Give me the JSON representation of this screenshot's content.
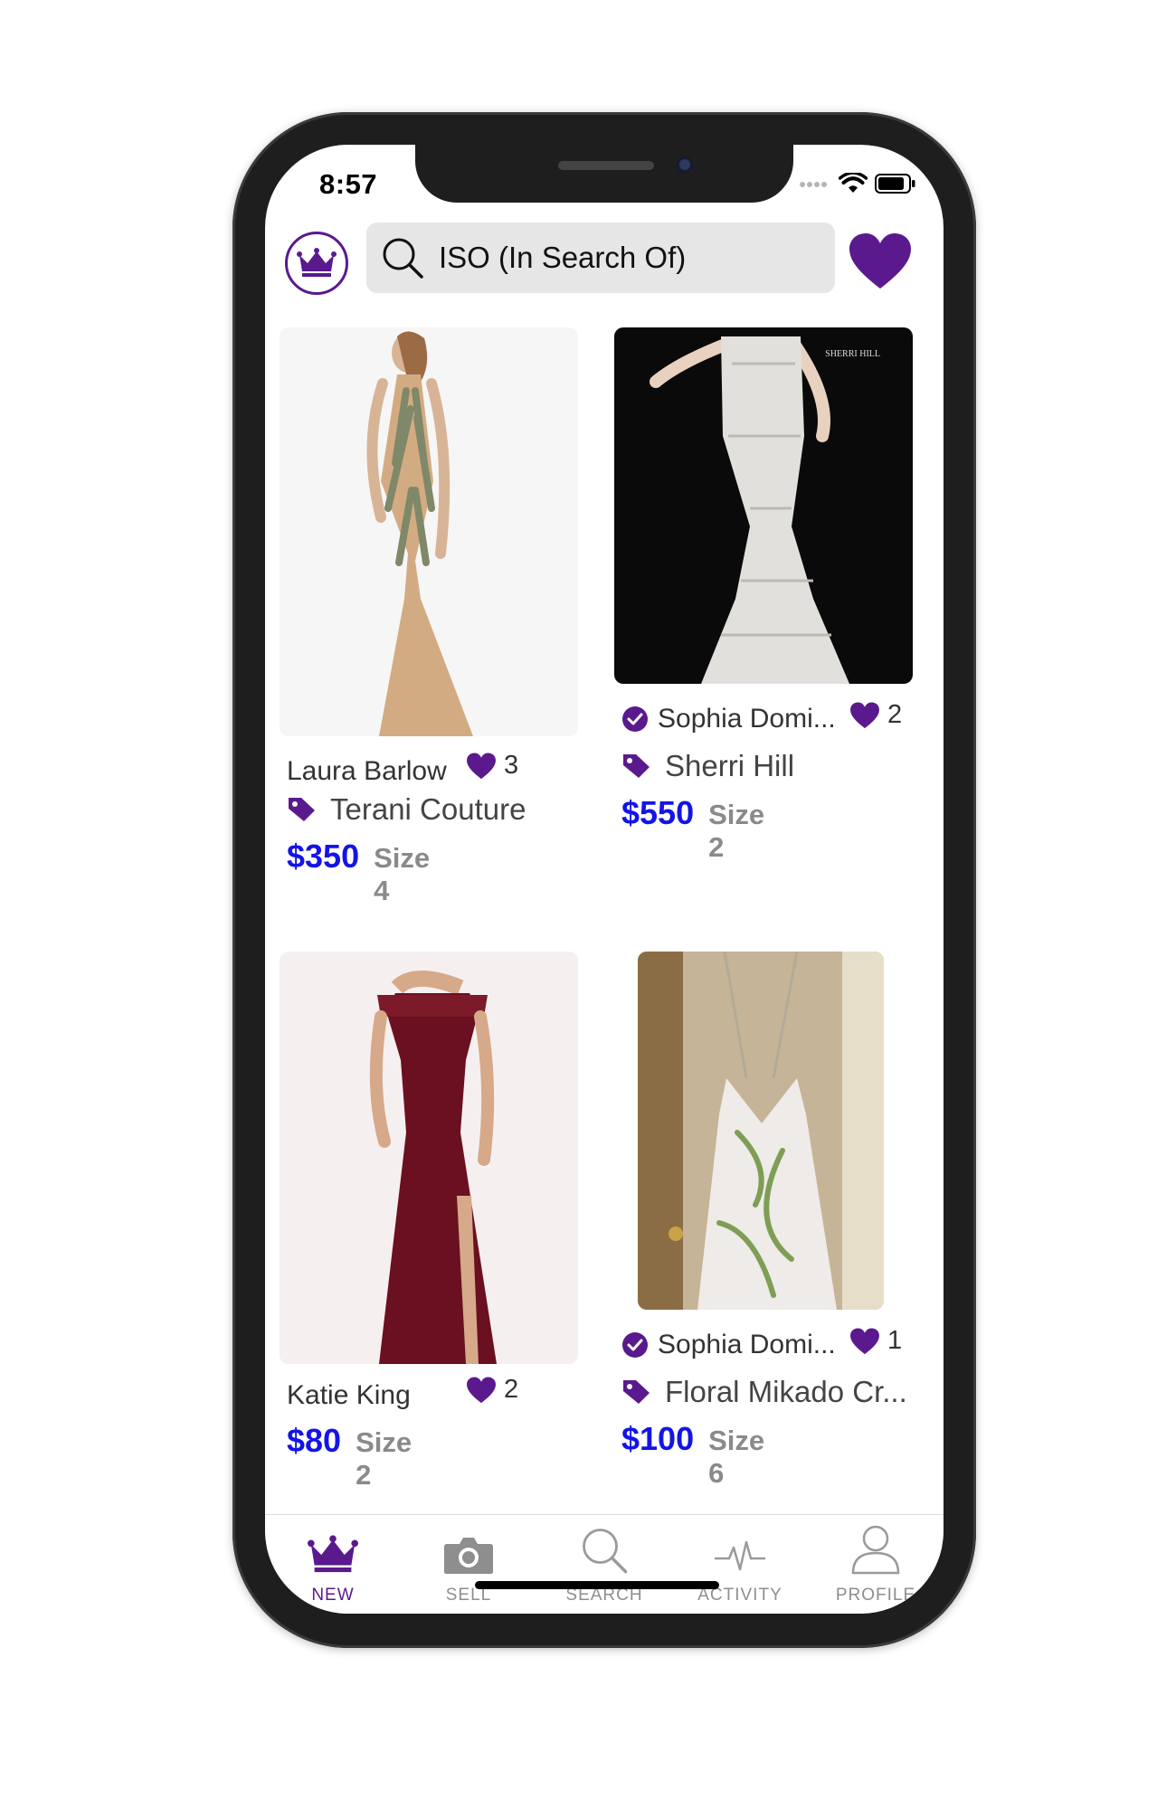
{
  "status_bar": {
    "time": "8:57"
  },
  "header": {
    "search_placeholder": "ISO (In Search Of)",
    "icons": {
      "home": "crown-icon",
      "search": "search-icon",
      "favorites": "heart-icon"
    }
  },
  "colors": {
    "brand_purple": "#5a1a8e",
    "price_blue": "#1414e6",
    "size_gray": "#8a8a8a"
  },
  "listings": [
    {
      "seller": "Laura Barlow",
      "verified": false,
      "likes": "3",
      "brand": "Terani Couture",
      "price": "$350",
      "size": "Size 4"
    },
    {
      "seller": "Sophia Domi...",
      "verified": true,
      "likes": "2",
      "brand": "Sherri Hill",
      "price": "$550",
      "size": "Size 2",
      "image_watermark": "SHERRI HILL"
    },
    {
      "seller": "Katie King",
      "verified": false,
      "likes": "2",
      "brand": "",
      "price": "$80",
      "size": "Size 2"
    },
    {
      "seller": "Sophia Domi...",
      "verified": true,
      "likes": "1",
      "brand": "Floral Mikado Cr...",
      "price": "$100",
      "size": "Size 6"
    }
  ],
  "tabbar": {
    "tabs": [
      {
        "label": "NEW",
        "icon": "crown-icon",
        "active": true
      },
      {
        "label": "SELL",
        "icon": "camera-icon",
        "active": false
      },
      {
        "label": "SEARCH",
        "icon": "search-icon",
        "active": false
      },
      {
        "label": "ACTIVITY",
        "icon": "activity-icon",
        "active": false
      },
      {
        "label": "PROFILE",
        "icon": "profile-icon",
        "active": false
      }
    ]
  }
}
